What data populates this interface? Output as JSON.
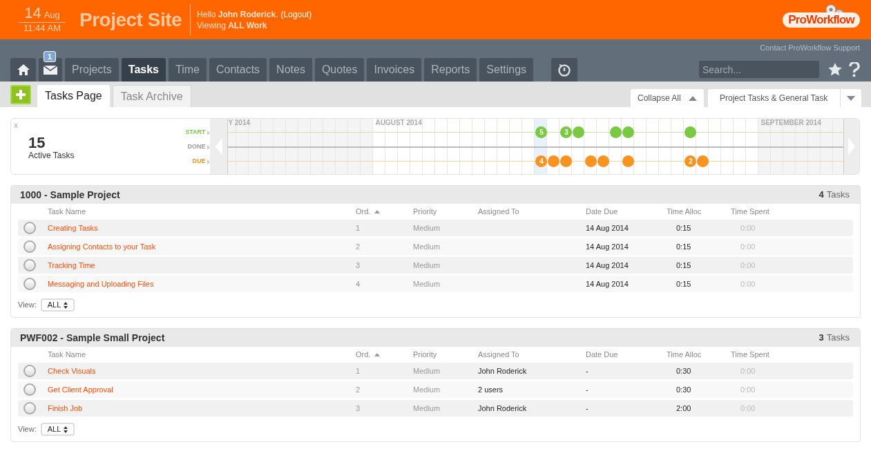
{
  "header": {
    "day": "14",
    "month": "Aug",
    "time": "11:44 AM",
    "site_title": "Project Site",
    "greeting": "Hello **John Roderick**.",
    "logout": "(Logout)",
    "viewing": "Viewing **ALL Work**",
    "logo": "ProWorkflow"
  },
  "support_link": "Contact ProWorkflow Support",
  "nav_tabs": [
    {
      "kind": "home",
      "selected": false
    },
    {
      "kind": "mail",
      "badge": "1",
      "selected": false
    },
    {
      "kind": "text",
      "label": "Projects",
      "selected": false
    },
    {
      "kind": "text",
      "label": "Tasks",
      "selected": true
    },
    {
      "kind": "text",
      "label": "Time",
      "selected": false
    },
    {
      "kind": "text",
      "label": "Contacts",
      "selected": false
    },
    {
      "kind": "text",
      "label": "Notes",
      "selected": false
    },
    {
      "kind": "text",
      "label": "Quotes",
      "selected": false
    },
    {
      "kind": "text",
      "label": "Invoices",
      "selected": false
    },
    {
      "kind": "text",
      "label": "Reports",
      "selected": false
    },
    {
      "kind": "text",
      "label": "Settings",
      "selected": false
    },
    {
      "kind": "timer",
      "selected": false
    }
  ],
  "search": {
    "placeholder": "Search..."
  },
  "sub_tabs": [
    {
      "label": "Tasks Page",
      "selected": true
    },
    {
      "label": "Task Archive",
      "selected": false
    }
  ],
  "collapse_button": "Collapse All",
  "filter_select": "Project Tasks & General Task",
  "summary": {
    "close": "x",
    "count": "15",
    "label": "Active Tasks"
  },
  "timeline": {
    "rows": [
      {
        "kind": "start",
        "label": "START"
      },
      {
        "kind": "done",
        "label": "DONE"
      },
      {
        "kind": "due",
        "label": "DUE"
      }
    ],
    "months": [
      "Y 2014",
      "AUGUST 2014",
      "SEPTEMBER 2014"
    ],
    "dots": [
      {
        "kind": "start",
        "count": "5"
      },
      {
        "kind": "start",
        "count": "3"
      },
      {
        "kind": "start"
      },
      {
        "kind": "start"
      },
      {
        "kind": "start"
      },
      {
        "kind": "start"
      },
      {
        "kind": "due",
        "count": "4"
      },
      {
        "kind": "due"
      },
      {
        "kind": "due"
      },
      {
        "kind": "due"
      },
      {
        "kind": "due"
      },
      {
        "kind": "due"
      },
      {
        "kind": "due",
        "count": "2"
      },
      {
        "kind": "due"
      }
    ]
  },
  "projects": [
    {
      "title": "1000 - Sample Project",
      "task_count": "4",
      "tasks_word": "Tasks",
      "columns": [
        "Task Name",
        "Ord.",
        "Priority",
        "Assigned To",
        "Date Due",
        "Time Alloc",
        "Time Spent"
      ],
      "rows": [
        {
          "done": false,
          "cells": [
            "Creating Tasks",
            "1",
            "Medium",
            "",
            "14 Aug 2014",
            "0:15",
            "0:00"
          ]
        },
        {
          "done": false,
          "cells": [
            "Assigning Contacts to your Task",
            "2",
            "Medium",
            "",
            "14 Aug 2014",
            "0:15",
            "0:00"
          ]
        },
        {
          "done": false,
          "cells": [
            "Tracking Time",
            "3",
            "Medium",
            "",
            "14 Aug 2014",
            "0:15",
            "0:00"
          ]
        },
        {
          "done": false,
          "cells": [
            "Messaging and Uploading Files",
            "4",
            "Medium",
            "",
            "14 Aug 2014",
            "0:15",
            "0:00"
          ]
        }
      ],
      "view_label": "View:",
      "view_value": "ALL"
    },
    {
      "title": "PWF002 - Sample Small Project",
      "task_count": "3",
      "tasks_word": "Tasks",
      "columns": [
        "Task Name",
        "Ord.",
        "Priority",
        "Assigned To",
        "Date Due",
        "Time Alloc",
        "Time Spent"
      ],
      "rows": [
        {
          "done": false,
          "cells": [
            "Check Visuals",
            "1",
            "Medium",
            "John Roderick",
            "-",
            "0:30",
            "0:00"
          ]
        },
        {
          "done": false,
          "cells": [
            "Get Client Approval",
            "2",
            "Medium",
            "2 users",
            "-",
            "0:30",
            "0:00"
          ]
        },
        {
          "done": false,
          "cells": [
            "Finish Job",
            "3",
            "Medium",
            "John Roderick",
            "-",
            "2:00",
            "0:00"
          ]
        }
      ],
      "view_label": "View:",
      "view_value": "ALL"
    }
  ]
}
